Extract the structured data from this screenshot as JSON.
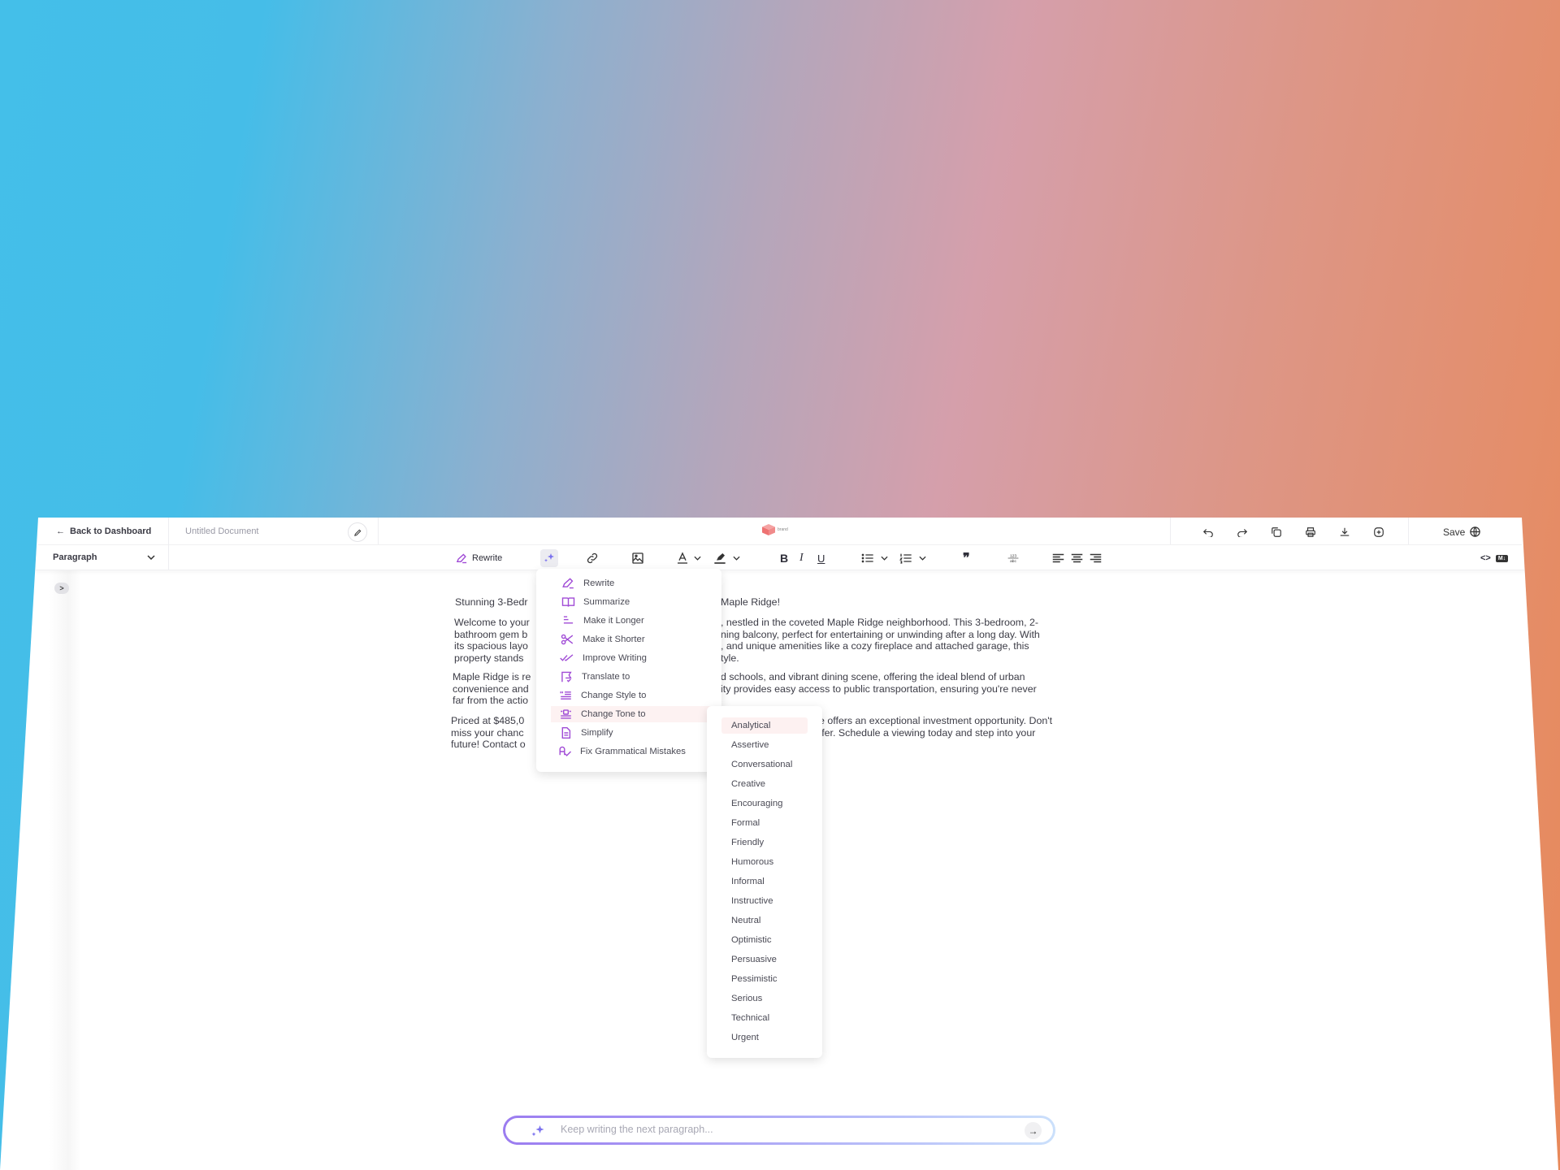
{
  "header": {
    "back_label": "Back to Dashboard",
    "document_title": "Untitled Document",
    "logo_text": "brand",
    "save_label": "Save",
    "icons": [
      "undo-icon",
      "redo-icon",
      "duplicate-icon",
      "print-icon",
      "download-icon",
      "add-icon",
      "globe-icon"
    ]
  },
  "toolbar": {
    "block_type": "Paragraph",
    "rewrite_label": "Rewrite"
  },
  "document": {
    "title_left": "Stunning 3-Bedr",
    "title_right": "Maple Ridge!",
    "paragraphs": [
      {
        "left": [
          "Welcome to your",
          "bathroom gem b",
          "its spacious layo",
          "property stands"
        ],
        "right": [
          ", nestled in the coveted Maple Ridge neighborhood. This 3-bedroom, 2-",
          "ning balcony, perfect for entertaining or unwinding after a long day. With",
          ", and unique amenities like a cozy fireplace and attached garage, this",
          "tyle."
        ]
      },
      {
        "left": [
          "Maple Ridge is re",
          "convenience and",
          "far from the actio"
        ],
        "right": [
          "d schools, and vibrant dining scene, offering the ideal blend of urban",
          "ity provides easy access to public transportation, ensuring you're never"
        ]
      },
      {
        "left": [
          "Priced at $485,0",
          "miss your chanc",
          "future! Contact o"
        ],
        "right": [
          "e offers an exceptional investment opportunity. Don't",
          "ffer. Schedule a viewing today and step into your"
        ]
      }
    ]
  },
  "ai_menu": {
    "items": [
      {
        "label": "Rewrite",
        "icon": "pencil-icon"
      },
      {
        "label": "Summarize",
        "icon": "book-icon"
      },
      {
        "label": "Make it Longer",
        "icon": "lines-longer-icon"
      },
      {
        "label": "Make it Shorter",
        "icon": "scissors-icon"
      },
      {
        "label": "Improve Writing",
        "icon": "double-check-icon"
      },
      {
        "label": "Translate to",
        "icon": "translate-flag-icon"
      },
      {
        "label": "Change Style to",
        "icon": "style-icon"
      },
      {
        "label": "Change Tone to",
        "icon": "tone-icon"
      },
      {
        "label": "Simplify",
        "icon": "document-icon"
      },
      {
        "label": "Fix Grammatical Mistakes",
        "icon": "grammar-check-icon"
      }
    ],
    "active_index": 7
  },
  "tone_menu": {
    "items": [
      "Analytical",
      "Assertive",
      "Conversational",
      "Creative",
      "Encouraging",
      "Formal",
      "Friendly",
      "Humorous",
      "Informal",
      "Instructive",
      "Neutral",
      "Optimistic",
      "Persuasive",
      "Pessimistic",
      "Serious",
      "Technical",
      "Urgent"
    ],
    "active_index": 0
  },
  "prompt": {
    "placeholder": "Keep writing the next paragraph...",
    "value": ""
  },
  "colors": {
    "accent_purple": "#a04bd6",
    "ai_sparkle": "#7b72ee",
    "menu_hover": "#fdf2f2"
  }
}
